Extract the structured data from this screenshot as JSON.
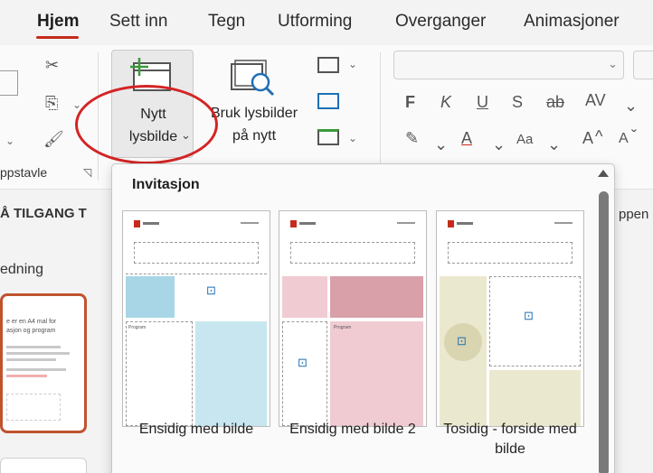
{
  "tabs": {
    "hjem": "Hjem",
    "sett_inn": "Sett inn",
    "tegn": "Tegn",
    "utforming": "Utforming",
    "overganger": "Overganger",
    "animasjoner": "Animasjoner"
  },
  "ribbon": {
    "new_slide_line1": "Nytt",
    "new_slide_line2": "lysbilde",
    "reuse_line1": "Bruk lysbilder",
    "reuse_line2": "på nytt",
    "clipboard_group": "ppstavle",
    "bold": "F",
    "italic": "K",
    "underline": "U",
    "shadow": "S",
    "strike": "ab",
    "spacing": "AV",
    "case": "Aa",
    "grow": "A",
    "shrink": "A"
  },
  "background": {
    "quick_access": "Å TILGANG T",
    "right_fragment": "ppen",
    "outline_heading": "edning",
    "thumb_text": "e er en A4 mal for\nasjon og program"
  },
  "gallery": {
    "title": "Invitasjon",
    "layouts": [
      {
        "label": "Ensidig med bilde",
        "accent": "#a9d6e6",
        "fill": "#c7e6f0"
      },
      {
        "label": "Ensidig med bilde 2",
        "accent": "#d9a0aa",
        "fill": "#f0cbd2"
      },
      {
        "label": "Tosidig - forside med bilde",
        "accent": "#d8d5b0",
        "fill": "#ebe8d0"
      }
    ],
    "small_text": "Program"
  },
  "colors": {
    "accent_red": "#c42b1c",
    "annotation": "#d42424",
    "selection": "#c0532e"
  }
}
